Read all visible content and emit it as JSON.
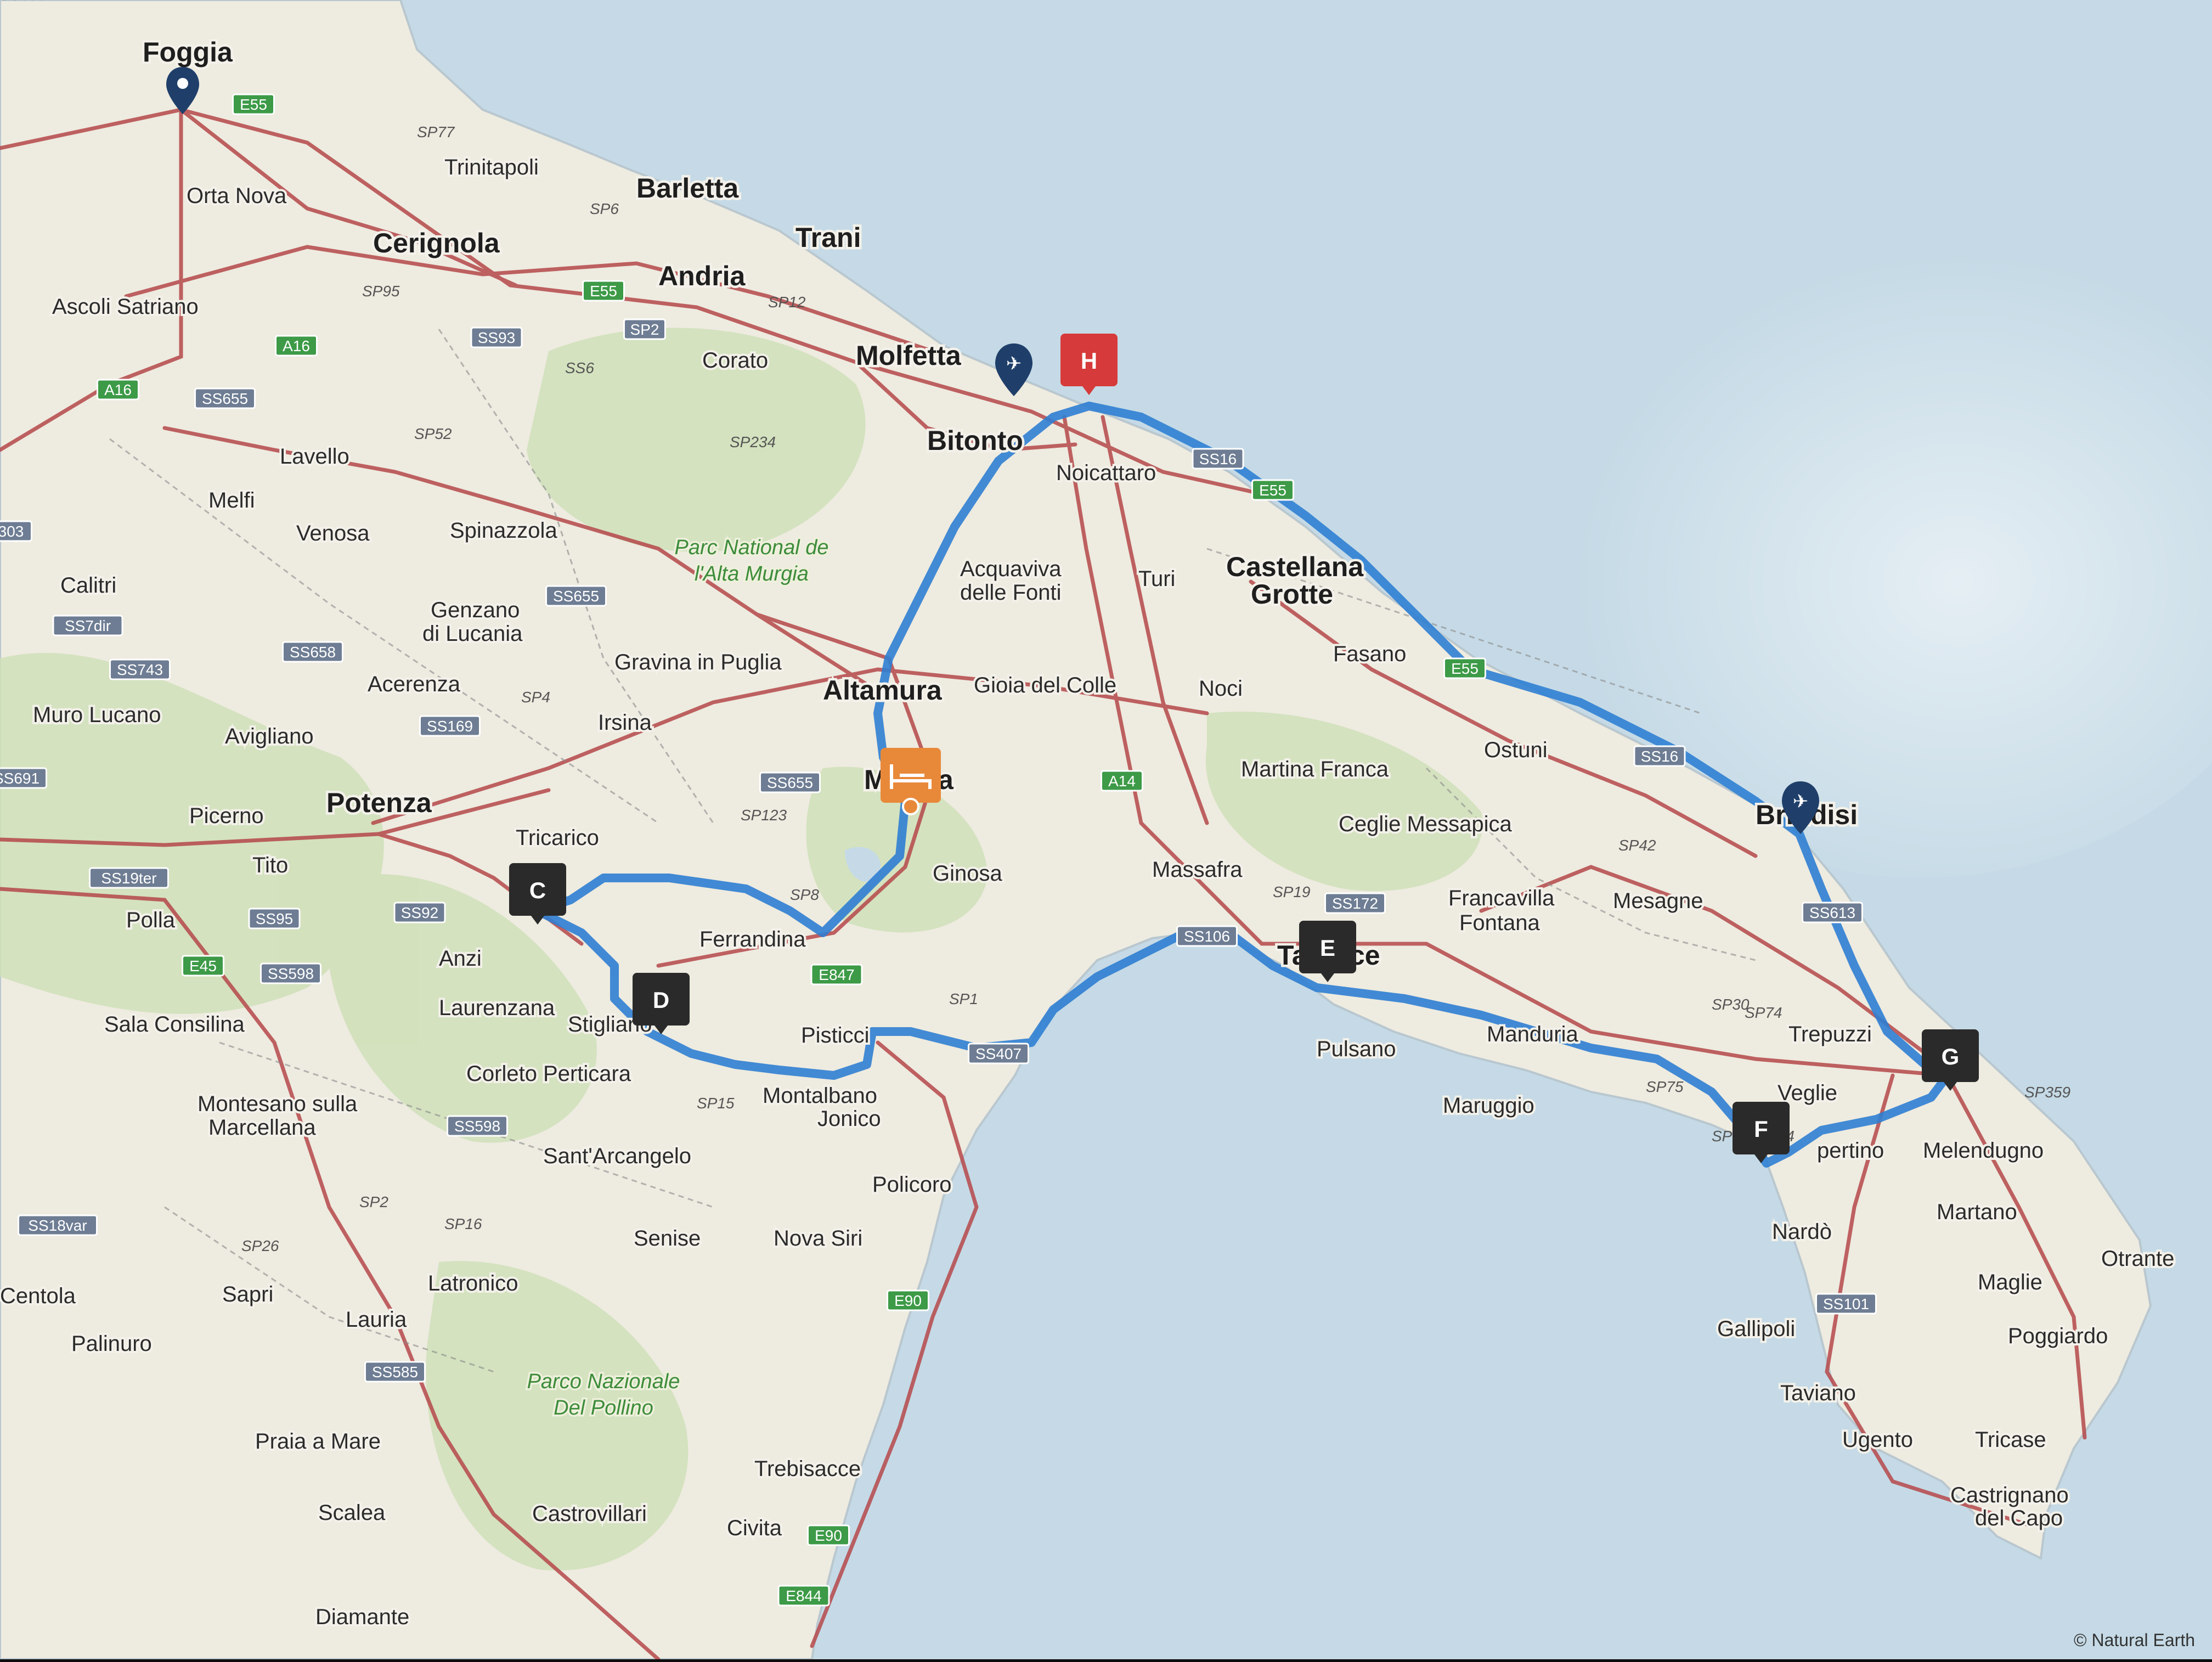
{
  "map": {
    "attribution": "© Natural Earth",
    "route_color": "#2f7fd3",
    "sea_color": "#c5dae6",
    "land_color": "#efece2",
    "cities": [
      {
        "name": "Foggia",
        "style": "major"
      },
      {
        "name": "Barletta",
        "style": "major"
      },
      {
        "name": "Trani",
        "style": "major"
      },
      {
        "name": "Cerignola",
        "style": "major"
      },
      {
        "name": "Andria",
        "style": "major"
      },
      {
        "name": "Molfetta",
        "style": "major"
      },
      {
        "name": "Bitonto",
        "style": "major"
      },
      {
        "name": "Altamura",
        "style": "major"
      },
      {
        "name": "Potenza",
        "style": "major"
      },
      {
        "name": "Castellana",
        "style": "major"
      },
      {
        "name": "Grotte",
        "style": "major"
      },
      {
        "name": "Brindisi",
        "style": "major"
      },
      {
        "name": "Trinitapoli",
        "style": "city"
      },
      {
        "name": "Orta Nova",
        "style": "city"
      },
      {
        "name": "Ascoli Satriano",
        "style": "city"
      },
      {
        "name": "Corato",
        "style": "city"
      },
      {
        "name": "Lavello",
        "style": "city"
      },
      {
        "name": "Melfi",
        "style": "city"
      },
      {
        "name": "Venosa",
        "style": "city"
      },
      {
        "name": "Spinazzola",
        "style": "city"
      },
      {
        "name": "Calitri",
        "style": "city"
      },
      {
        "name": "Genzano",
        "style": "city"
      },
      {
        "name": "di Lucania",
        "style": "city"
      },
      {
        "name": "Gravina in Puglia",
        "style": "city"
      },
      {
        "name": "Acerenza",
        "style": "city"
      },
      {
        "name": "Irsina",
        "style": "city"
      },
      {
        "name": "Muro Lucano",
        "style": "city"
      },
      {
        "name": "Avigliano",
        "style": "city"
      },
      {
        "name": "Picerno",
        "style": "city"
      },
      {
        "name": "Tito",
        "style": "city"
      },
      {
        "name": "Tricarico",
        "style": "city"
      },
      {
        "name": "Polla",
        "style": "city"
      },
      {
        "name": "Anzi",
        "style": "city"
      },
      {
        "name": "Laurenzana",
        "style": "city"
      },
      {
        "name": "Sala Consilina",
        "style": "city"
      },
      {
        "name": "Stigliano",
        "style": "city"
      },
      {
        "name": "Corleto Perticara",
        "style": "city"
      },
      {
        "name": "Montesano sulla",
        "style": "city"
      },
      {
        "name": "Marcellana",
        "style": "city"
      },
      {
        "name": "Sant'Arcangelo",
        "style": "city"
      },
      {
        "name": "Ferrandina",
        "style": "city"
      },
      {
        "name": "Pisticci",
        "style": "city"
      },
      {
        "name": "Montalbano",
        "style": "city"
      },
      {
        "name": "Jonico",
        "style": "city"
      },
      {
        "name": "Policoro",
        "style": "city"
      },
      {
        "name": "Senise",
        "style": "city"
      },
      {
        "name": "Nova Siri",
        "style": "city"
      },
      {
        "name": "Latronico",
        "style": "city"
      },
      {
        "name": "Centola",
        "style": "city"
      },
      {
        "name": "Sapri",
        "style": "city"
      },
      {
        "name": "Lauria",
        "style": "city"
      },
      {
        "name": "Palinuro",
        "style": "city"
      },
      {
        "name": "Praia a Mare",
        "style": "city"
      },
      {
        "name": "Scalea",
        "style": "city"
      },
      {
        "name": "Castrovillari",
        "style": "city"
      },
      {
        "name": "Civita",
        "style": "city"
      },
      {
        "name": "Trebisacce",
        "style": "city"
      },
      {
        "name": "Diamante",
        "style": "city"
      },
      {
        "name": "Noicattaro",
        "style": "city"
      },
      {
        "name": "Acquaviva",
        "style": "city"
      },
      {
        "name": "delle Fonti",
        "style": "city"
      },
      {
        "name": "Turi",
        "style": "city"
      },
      {
        "name": "Gioia del Colle",
        "style": "city"
      },
      {
        "name": "Noci",
        "style": "city"
      },
      {
        "name": "Ginosa",
        "style": "city"
      },
      {
        "name": "Massafra",
        "style": "city"
      },
      {
        "name": "Martina Franca",
        "style": "city"
      },
      {
        "name": "Fasano",
        "style": "city"
      },
      {
        "name": "Ostuni",
        "style": "city"
      },
      {
        "name": "Ceglie Messapica",
        "style": "city"
      },
      {
        "name": "Francavilla",
        "style": "city"
      },
      {
        "name": "Fontana",
        "style": "city"
      },
      {
        "name": "Mesagne",
        "style": "city"
      },
      {
        "name": "Pulsano",
        "style": "city"
      },
      {
        "name": "Manduria",
        "style": "city"
      },
      {
        "name": "Maruggio",
        "style": "city"
      },
      {
        "name": "Trepuzzi",
        "style": "city"
      },
      {
        "name": "Veglie",
        "style": "city"
      },
      {
        "name": "Melendugno",
        "style": "city"
      },
      {
        "name": "Martano",
        "style": "city"
      },
      {
        "name": "Nardò",
        "style": "city"
      },
      {
        "name": "Otrante",
        "style": "city"
      },
      {
        "name": "Maglie",
        "style": "city"
      },
      {
        "name": "Gallipoli",
        "style": "city"
      },
      {
        "name": "Poggiardo",
        "style": "city"
      },
      {
        "name": "Taviano",
        "style": "city"
      },
      {
        "name": "Ugento",
        "style": "city"
      },
      {
        "name": "Tricase",
        "style": "city"
      },
      {
        "name": "Castrignano",
        "style": "city"
      },
      {
        "name": "del Capo",
        "style": "city"
      },
      {
        "name": "M",
        "style": "major"
      },
      {
        "name": "a",
        "style": "major"
      },
      {
        "name": "Ta",
        "style": "major"
      },
      {
        "name": "ce",
        "style": "major"
      },
      {
        "name": "pertino",
        "style": "city"
      }
    ],
    "parks": [
      {
        "line1": "Parc National de",
        "line2": "l'Alta Murgia"
      },
      {
        "line1": "Parco Nazionale",
        "line2": "Del Pollino"
      }
    ],
    "road_shields": [
      {
        "label": "E55",
        "type": "euro"
      },
      {
        "label": "E55",
        "type": "euro"
      },
      {
        "label": "E55",
        "type": "euro"
      },
      {
        "label": "E55",
        "type": "euro"
      },
      {
        "label": "A16",
        "type": "euro"
      },
      {
        "label": "A16",
        "type": "euro"
      },
      {
        "label": "A14",
        "type": "euro"
      },
      {
        "label": "E45",
        "type": "euro"
      },
      {
        "label": "E847",
        "type": "euro"
      },
      {
        "label": "E90",
        "type": "euro"
      },
      {
        "label": "E90",
        "type": "euro"
      },
      {
        "label": "E844",
        "type": "euro"
      },
      {
        "label": "SS93",
        "type": "state"
      },
      {
        "label": "SP2",
        "type": "state"
      },
      {
        "label": "SS655",
        "type": "state"
      },
      {
        "label": "SS655",
        "type": "state"
      },
      {
        "label": "SS655",
        "type": "state"
      },
      {
        "label": "SS658",
        "type": "state"
      },
      {
        "label": "SS7dir",
        "type": "state"
      },
      {
        "label": "SS743",
        "type": "state"
      },
      {
        "label": "SS169",
        "type": "state"
      },
      {
        "label": "SS691",
        "type": "state"
      },
      {
        "label": "SS19ter",
        "type": "state"
      },
      {
        "label": "SS95",
        "type": "state"
      },
      {
        "label": "SS92",
        "type": "state"
      },
      {
        "label": "SS598",
        "type": "state"
      },
      {
        "label": "SS598",
        "type": "state"
      },
      {
        "label": "SS18var",
        "type": "state"
      },
      {
        "label": "SS585",
        "type": "state"
      },
      {
        "label": "SS16",
        "type": "state"
      },
      {
        "label": "SS16",
        "type": "state"
      },
      {
        "label": "SS172",
        "type": "state"
      },
      {
        "label": "SS106",
        "type": "state"
      },
      {
        "label": "SS407",
        "type": "state"
      },
      {
        "label": "SS613",
        "type": "state"
      },
      {
        "label": "SS101",
        "type": "state"
      },
      {
        "label": "303",
        "type": "state"
      }
    ],
    "road_refs": [
      "SP77",
      "SP6",
      "SP95",
      "SP12",
      "SS6",
      "SP234",
      "SP52",
      "SP4",
      "SP123",
      "SP8",
      "SP1",
      "SP15",
      "SP2",
      "SP26",
      "SP16",
      "SP19",
      "SP42",
      "SP30",
      "SP74",
      "SP75",
      "SPexSS174",
      "SP359",
      "SS366"
    ],
    "route_markers": [
      {
        "letter": "C",
        "color": "#2a2a2a"
      },
      {
        "letter": "D",
        "color": "#2a2a2a"
      },
      {
        "letter": "E",
        "color": "#2a2a2a"
      },
      {
        "letter": "F",
        "color": "#2a2a2a"
      },
      {
        "letter": "G",
        "color": "#2a2a2a"
      },
      {
        "letter": "H",
        "color": "#d63a3a"
      }
    ],
    "hotel_marker": {
      "icon": "bed-icon",
      "color": "#e8893a"
    },
    "airports": [
      {
        "icon": "airplane-icon"
      },
      {
        "icon": "airplane-icon"
      }
    ]
  }
}
